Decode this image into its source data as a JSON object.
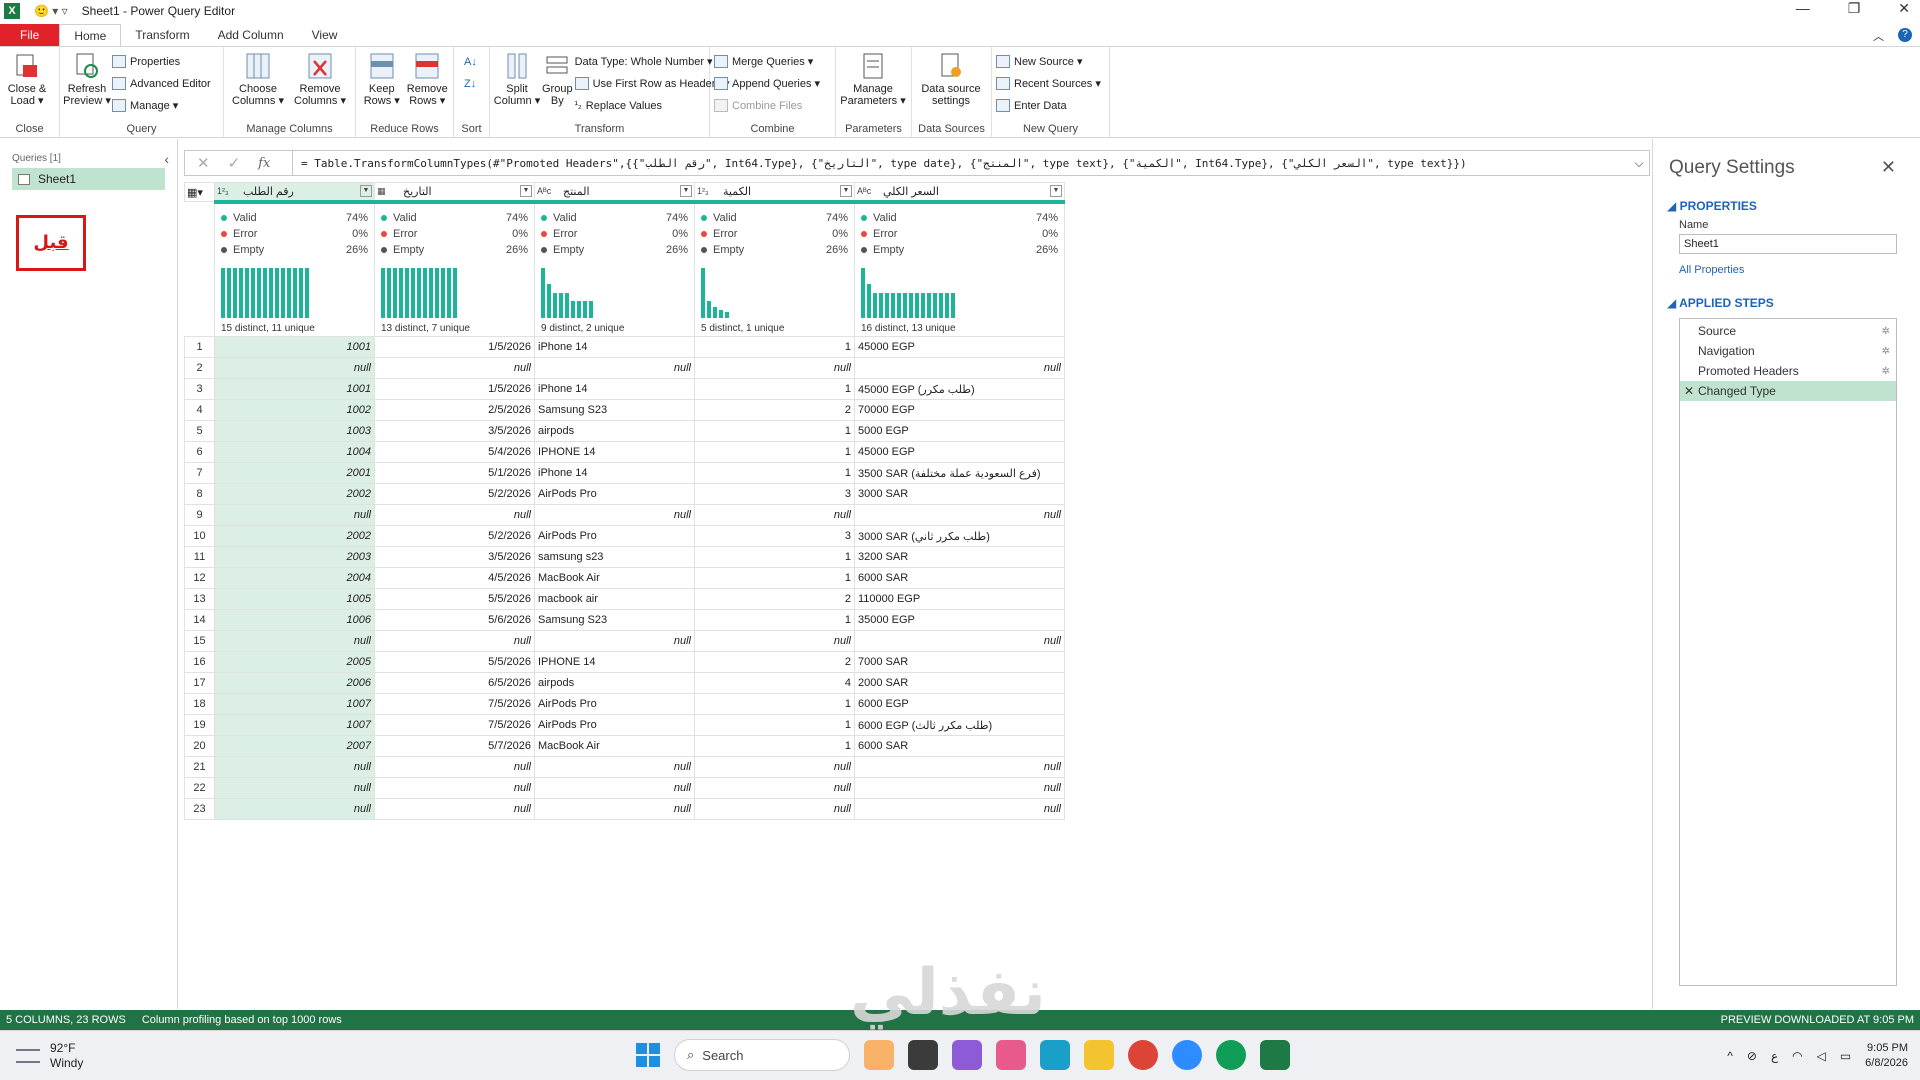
{
  "window": {
    "title": "Sheet1 - Power Query Editor",
    "app_badge": "X",
    "quick_access": "🙂 ▾  ▿"
  },
  "tabs": [
    "File",
    "Home",
    "Transform",
    "Add Column",
    "View"
  ],
  "ribbon": {
    "close": {
      "btn": "Close &\nLoad ▾",
      "label": "Close"
    },
    "query": {
      "refresh": "Refresh\nPreview ▾",
      "properties": "Properties",
      "advanced": "Advanced Editor",
      "manage": "Manage ▾",
      "label": "Query"
    },
    "manage_columns": {
      "choose": "Choose\nColumns ▾",
      "remove": "Remove\nColumns ▾",
      "label": "Manage Columns"
    },
    "reduce_rows": {
      "keep": "Keep\nRows ▾",
      "remove": "Remove\nRows ▾",
      "label": "Reduce Rows"
    },
    "sort": {
      "label": "Sort"
    },
    "transform": {
      "split": "Split\nColumn ▾",
      "group": "Group\nBy",
      "datatype": "Data Type: Whole Number ▾",
      "first_row": "Use First Row as Headers ▾",
      "replace": "Replace Values",
      "label": "Transform"
    },
    "combine": {
      "merge": "Merge Queries ▾",
      "append": "Append Queries ▾",
      "files": "Combine Files",
      "label": "Combine"
    },
    "parameters": {
      "manage": "Manage\nParameters ▾",
      "label": "Parameters"
    },
    "data_sources": {
      "settings": "Data source\nsettings",
      "label": "Data Sources"
    },
    "new_query": {
      "new_source": "New Source ▾",
      "recent": "Recent Sources ▾",
      "enter": "Enter Data",
      "label": "New Query"
    }
  },
  "queries": {
    "header": "Queries [1]",
    "items": [
      "Sheet1"
    ],
    "stamp": "قبل"
  },
  "formula": "= Table.TransformColumnTypes(#\"Promoted Headers\",{{\"رقم الطلب\", Int64.Type}, {\"التاريخ\", type date}, {\"المنتج\", type text}, {\"الكمية\", Int64.Type}, {\"السعر الكلي\", type text}})",
  "columns": [
    {
      "name": "رقم الطلب",
      "type_icon": "1²₃",
      "valid": "74%",
      "error": "0%",
      "empty": "26%",
      "distinct": "15 distinct, 11 unique",
      "bars": [
        0.9,
        0.9,
        0.9,
        0.9,
        0.9,
        0.9,
        0.9,
        0.9,
        0.9,
        0.9,
        0.9,
        0.9,
        0.9,
        0.9,
        0.9
      ]
    },
    {
      "name": "التاريخ",
      "type_icon": "▦",
      "valid": "74%",
      "error": "0%",
      "empty": "26%",
      "distinct": "13 distinct, 7 unique",
      "bars": [
        0.9,
        0.9,
        0.9,
        0.9,
        0.9,
        0.9,
        0.9,
        0.9,
        0.9,
        0.9,
        0.9,
        0.9,
        0.9
      ]
    },
    {
      "name": "المنتج",
      "type_icon": "Aᴮᴄ",
      "valid": "74%",
      "error": "0%",
      "empty": "26%",
      "distinct": "9 distinct, 2 unique",
      "bars": [
        0.9,
        0.6,
        0.45,
        0.45,
        0.45,
        0.3,
        0.3,
        0.3,
        0.3
      ]
    },
    {
      "name": "الكمية",
      "type_icon": "1²₃",
      "valid": "74%",
      "error": "0%",
      "empty": "26%",
      "distinct": "5 distinct, 1 unique",
      "bars": [
        0.9,
        0.3,
        0.2,
        0.15,
        0.1
      ]
    },
    {
      "name": "السعر الكلي",
      "type_icon": "Aᴮᴄ",
      "valid": "74%",
      "error": "0%",
      "empty": "26%",
      "distinct": "16 distinct, 13 unique",
      "bars": [
        0.9,
        0.6,
        0.45,
        0.45,
        0.45,
        0.45,
        0.45,
        0.45,
        0.45,
        0.45,
        0.45,
        0.45,
        0.45,
        0.45,
        0.45,
        0.45
      ]
    }
  ],
  "labels": {
    "valid": "Valid",
    "error": "Error",
    "empty": "Empty"
  },
  "rows": [
    [
      "1001",
      "1/5/2026",
      "iPhone 14",
      "1",
      "45000 EGP"
    ],
    [
      "null",
      "null",
      "null",
      "null",
      "null"
    ],
    [
      "1001",
      "1/5/2026",
      "iPhone 14",
      "1",
      "45000 EGP (طلب مكرر)"
    ],
    [
      "1002",
      "2/5/2026",
      "Samsung S23",
      "2",
      "70000 EGP"
    ],
    [
      "1003",
      "3/5/2026",
      "airpods",
      "1",
      "5000 EGP"
    ],
    [
      "1004",
      "5/4/2026",
      "IPHONE 14",
      "1",
      "45000 EGP"
    ],
    [
      "2001",
      "5/1/2026",
      "iPhone 14",
      "1",
      "3500 SAR (فرع السعودية عملة مختلفة)"
    ],
    [
      "2002",
      "5/2/2026",
      "AirPods Pro",
      "3",
      "3000 SAR"
    ],
    [
      "null",
      "null",
      "null",
      "null",
      "null"
    ],
    [
      "2002",
      "5/2/2026",
      "AirPods Pro",
      "3",
      "3000 SAR (طلب مكرر ثاني)"
    ],
    [
      "2003",
      "3/5/2026",
      "samsung s23",
      "1",
      "3200 SAR"
    ],
    [
      "2004",
      "4/5/2026",
      "MacBook Air",
      "1",
      "6000 SAR"
    ],
    [
      "1005",
      "5/5/2026",
      "macbook air",
      "2",
      "110000 EGP"
    ],
    [
      "1006",
      "5/6/2026",
      "Samsung S23",
      "1",
      "35000 EGP"
    ],
    [
      "null",
      "null",
      "null",
      "null",
      "null"
    ],
    [
      "2005",
      "5/5/2026",
      "IPHONE 14",
      "2",
      "7000 SAR"
    ],
    [
      "2006",
      "6/5/2026",
      "airpods",
      "4",
      "2000 SAR"
    ],
    [
      "1007",
      "7/5/2026",
      "AirPods Pro",
      "1",
      "6000 EGP"
    ],
    [
      "1007",
      "7/5/2026",
      "AirPods Pro",
      "1",
      "6000 EGP (طلب مكرر ثالث)"
    ],
    [
      "2007",
      "5/7/2026",
      "MacBook Air",
      "1",
      "6000 SAR"
    ],
    [
      "null",
      "null",
      "null",
      "null",
      "null"
    ],
    [
      "null",
      "null",
      "null",
      "null",
      "null"
    ],
    [
      "null",
      "null",
      "null",
      "null",
      "null"
    ]
  ],
  "settings": {
    "title": "Query Settings",
    "properties": "PROPERTIES",
    "name_label": "Name",
    "name_value": "Sheet1",
    "all_properties": "All Properties",
    "applied_steps": "APPLIED STEPS",
    "steps": [
      "Source",
      "Navigation",
      "Promoted Headers",
      "Changed Type"
    ]
  },
  "status": {
    "left1": "5 COLUMNS, 23 ROWS",
    "left2": "Column profiling based on top 1000 rows",
    "right": "PREVIEW DOWNLOADED AT 9:05 PM"
  },
  "watermark": "نفذلي",
  "taskbar": {
    "temp": "92°F",
    "weather": "Windy",
    "search": "Search",
    "lang": "ع",
    "time": "9:05 PM",
    "date": "6/8/2026"
  },
  "colors": {
    "accent": "#1cb59a",
    "status_green": "#217346",
    "selected": "#bfe3cf",
    "file_tab": "#e2222b"
  }
}
